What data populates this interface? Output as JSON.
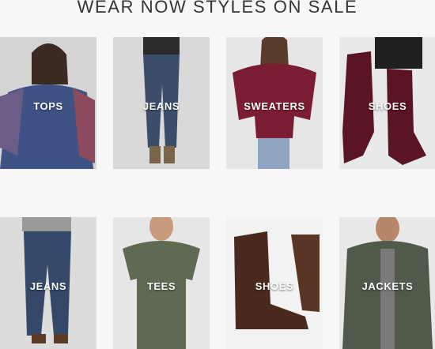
{
  "heading": "WEAR NOW STYLES ON SALE",
  "row1": [
    {
      "label": "TOPS"
    },
    {
      "label": "JEANS"
    },
    {
      "label": "SWEATERS"
    },
    {
      "label": "SHOES"
    }
  ],
  "row2": [
    {
      "label": "JEANS"
    },
    {
      "label": "TEES"
    },
    {
      "label": "SHOES"
    },
    {
      "label": "JACKETS"
    }
  ],
  "colors": {
    "background": "#f7f7f7",
    "tile_bg": "#d9d9d9",
    "label": "#ffffff"
  }
}
